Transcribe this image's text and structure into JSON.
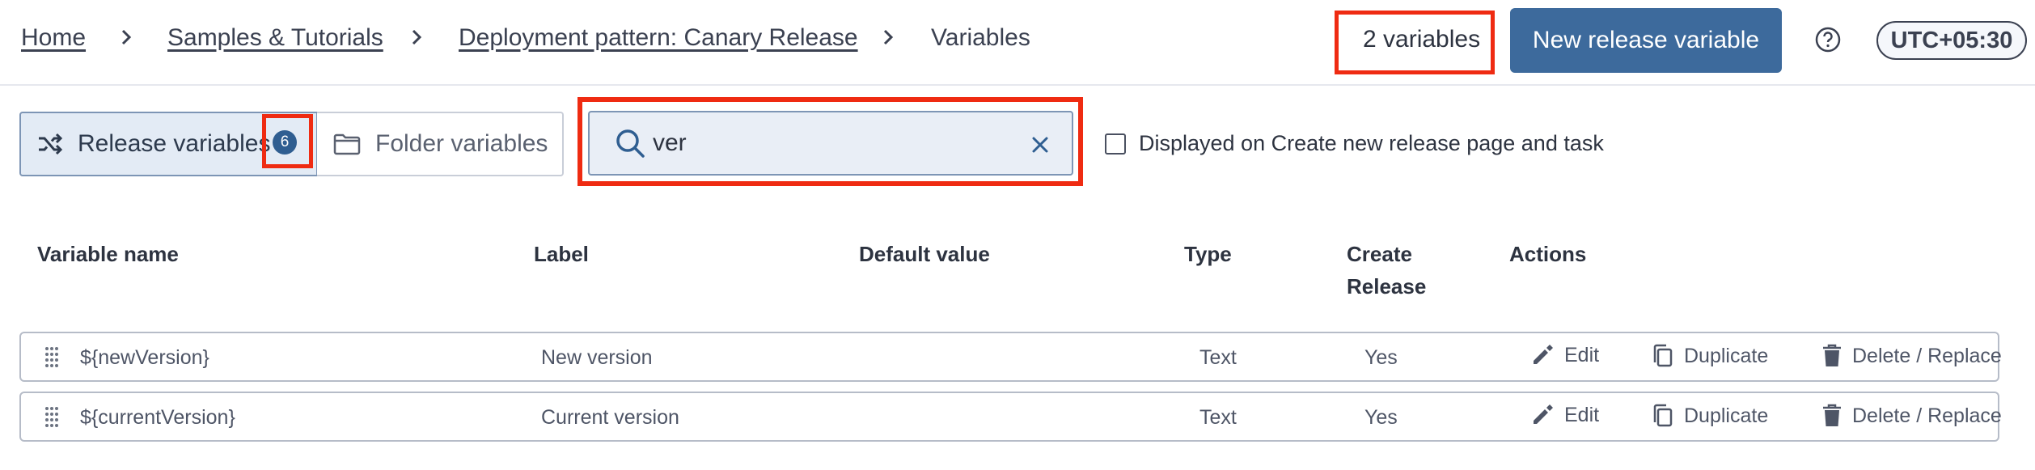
{
  "breadcrumb": {
    "items": [
      {
        "label": "Home"
      },
      {
        "label": "Samples & Tutorials"
      },
      {
        "label": "Deployment pattern: Canary Release"
      },
      {
        "label": "Variables"
      }
    ]
  },
  "header": {
    "variables_count": "2 variables",
    "new_button_label": "New release variable",
    "timezone": "UTC+05:30"
  },
  "filters": {
    "tabs": [
      {
        "label": "Release variables",
        "badge": "6",
        "active": true
      },
      {
        "label": "Folder variables",
        "active": false
      }
    ],
    "search_value": "ver",
    "checkbox_label": "Displayed on Create new release page and task",
    "checkbox_checked": false
  },
  "table": {
    "columns": {
      "name": "Variable name",
      "label": "Label",
      "default_value": "Default value",
      "type": "Type",
      "create_release_line1": "Create",
      "create_release_line2": "Release",
      "actions": "Actions"
    },
    "rows": [
      {
        "name": "${newVersion}",
        "label": "New version",
        "default_value": "",
        "type": "Text",
        "create_release": "Yes"
      },
      {
        "name": "${currentVersion}",
        "label": "Current version",
        "default_value": "",
        "type": "Text",
        "create_release": "Yes"
      }
    ],
    "actions": {
      "edit": "Edit",
      "duplicate": "Duplicate",
      "delete": "Delete / Replace"
    }
  },
  "colors": {
    "primary": "#3d6a9c",
    "highlight": "#ef2b12",
    "text": "#3b4151"
  },
  "icons": [
    "chevron-right-icon",
    "help-circle-icon",
    "shuffle-icon",
    "folder-icon",
    "search-icon",
    "close-icon",
    "drag-handle-icon",
    "edit-icon",
    "duplicate-icon",
    "trash-icon"
  ]
}
